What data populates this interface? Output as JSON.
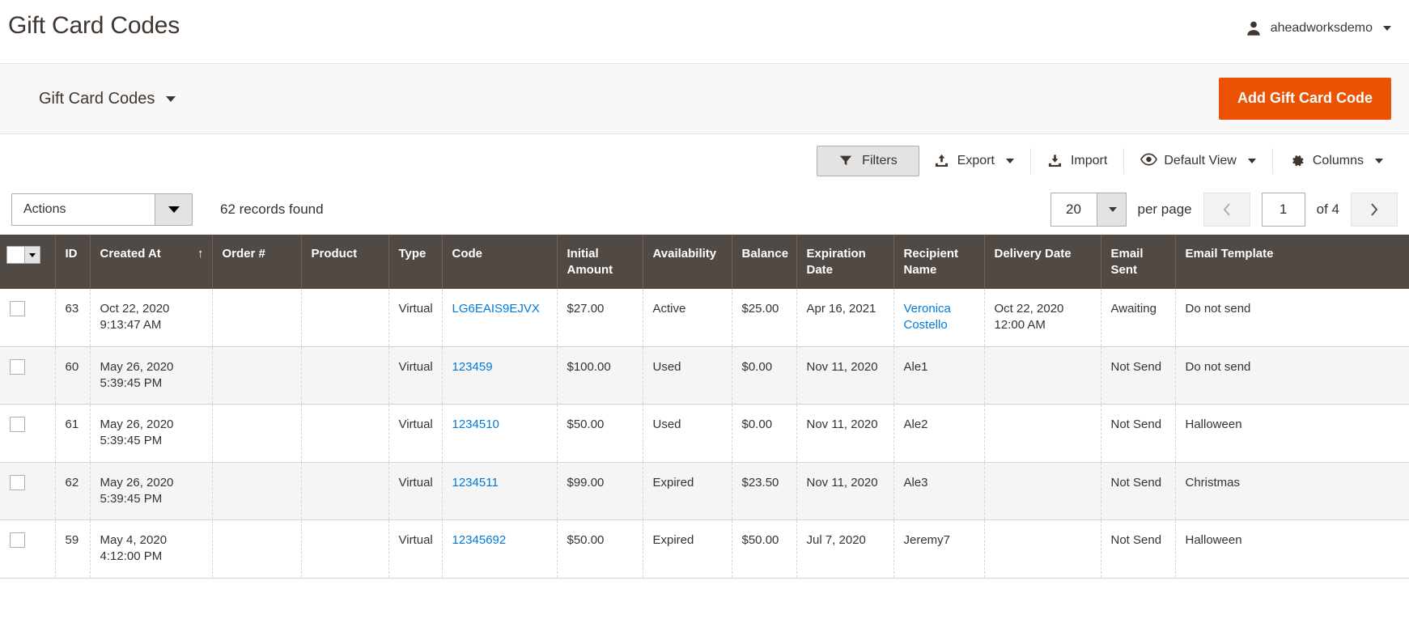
{
  "header": {
    "title": "Gift Card Codes",
    "user_name": "aheadworksdemo",
    "avatar_icon": "user-icon",
    "caret_icon": "chevron-down-icon"
  },
  "page_actions": {
    "switcher_label": "Gift Card Codes",
    "add_button_label": "Add Gift Card Code"
  },
  "toolbar": [
    {
      "label": "Filters",
      "icon": "filter-icon",
      "active": true,
      "has_caret": false
    },
    {
      "label": "Export",
      "icon": "export-icon",
      "active": false,
      "has_caret": true
    },
    {
      "label": "Import",
      "icon": "import-icon",
      "active": false,
      "has_caret": false
    },
    {
      "label": "Default View",
      "icon": "eye-icon",
      "active": false,
      "has_caret": true
    },
    {
      "label": "Columns",
      "icon": "gear-icon",
      "active": false,
      "has_caret": true
    }
  ],
  "grid_controls": {
    "actions_label": "Actions",
    "records_found": "62 records found",
    "per_page_value": "20",
    "per_page_label": "per page",
    "prev_icon": "chevron-left-icon",
    "next_icon": "chevron-right-icon",
    "current_page": "1",
    "of_label": "of 4"
  },
  "grid": {
    "columns": [
      {
        "key": "check",
        "label": "",
        "sort": ""
      },
      {
        "key": "id",
        "label": "ID",
        "sort": ""
      },
      {
        "key": "created_at",
        "label": "Created At",
        "sort": "↑"
      },
      {
        "key": "order",
        "label": "Order #",
        "sort": ""
      },
      {
        "key": "product",
        "label": "Product",
        "sort": ""
      },
      {
        "key": "type",
        "label": "Type",
        "sort": ""
      },
      {
        "key": "code",
        "label": "Code",
        "sort": ""
      },
      {
        "key": "initial",
        "label": "Initial Amount",
        "sort": ""
      },
      {
        "key": "avail",
        "label": "Availability",
        "sort": ""
      },
      {
        "key": "balance",
        "label": "Balance",
        "sort": ""
      },
      {
        "key": "expiration",
        "label": "Expiration Date",
        "sort": ""
      },
      {
        "key": "recipient",
        "label": "Recipient Name",
        "sort": ""
      },
      {
        "key": "delivery",
        "label": "Delivery Date",
        "sort": ""
      },
      {
        "key": "email_sent",
        "label": "Email Sent",
        "sort": ""
      },
      {
        "key": "template",
        "label": "Email Template",
        "sort": ""
      }
    ],
    "rows": [
      {
        "id": "63",
        "created_at_1": "Oct 22, 2020",
        "created_at_2": "9:13:47 AM",
        "order": "",
        "product": "",
        "type": "Virtual",
        "code": "LG6EAIS9EJVX",
        "initial": "$27.00",
        "avail": "Active",
        "balance": "$25.00",
        "expiration": "Apr 16, 2021",
        "recipient_1": "Veronica",
        "recipient_2": "Costello",
        "recipient_link": true,
        "delivery_1": "Oct 22, 2020",
        "delivery_2": "12:00 AM",
        "email_sent": "Awaiting",
        "template": "Do not send"
      },
      {
        "id": "60",
        "created_at_1": "May 26, 2020",
        "created_at_2": "5:39:45 PM",
        "order": "",
        "product": "",
        "type": "Virtual",
        "code": "123459",
        "initial": "$100.00",
        "avail": "Used",
        "balance": "$0.00",
        "expiration": "Nov 11, 2020",
        "recipient_1": "Ale1",
        "recipient_2": "",
        "recipient_link": false,
        "delivery_1": "",
        "delivery_2": "",
        "email_sent": "Not Send",
        "template": "Do not send"
      },
      {
        "id": "61",
        "created_at_1": "May 26, 2020",
        "created_at_2": "5:39:45 PM",
        "order": "",
        "product": "",
        "type": "Virtual",
        "code": "1234510",
        "initial": "$50.00",
        "avail": "Used",
        "balance": "$0.00",
        "expiration": "Nov 11, 2020",
        "recipient_1": "Ale2",
        "recipient_2": "",
        "recipient_link": false,
        "delivery_1": "",
        "delivery_2": "",
        "email_sent": "Not Send",
        "template": "Halloween"
      },
      {
        "id": "62",
        "created_at_1": "May 26, 2020",
        "created_at_2": "5:39:45 PM",
        "order": "",
        "product": "",
        "type": "Virtual",
        "code": "1234511",
        "initial": "$99.00",
        "avail": "Expired",
        "balance": "$23.50",
        "expiration": "Nov 11, 2020",
        "recipient_1": "Ale3",
        "recipient_2": "",
        "recipient_link": false,
        "delivery_1": "",
        "delivery_2": "",
        "email_sent": "Not Send",
        "template": "Christmas"
      },
      {
        "id": "59",
        "created_at_1": "May 4, 2020",
        "created_at_2": "4:12:00 PM",
        "order": "",
        "product": "",
        "type": "Virtual",
        "code": "12345692",
        "initial": "$50.00",
        "avail": "Expired",
        "balance": "$50.00",
        "expiration": "Jul 7, 2020",
        "recipient_1": "Jeremy7",
        "recipient_2": "",
        "recipient_link": false,
        "delivery_1": "",
        "delivery_2": "",
        "email_sent": "Not Send",
        "template": "Halloween"
      }
    ]
  },
  "colors": {
    "accent_orange": "#eb5202",
    "header_dark": "#514943",
    "link_blue": "#007bdb",
    "panel_gray": "#f8f8f8"
  }
}
